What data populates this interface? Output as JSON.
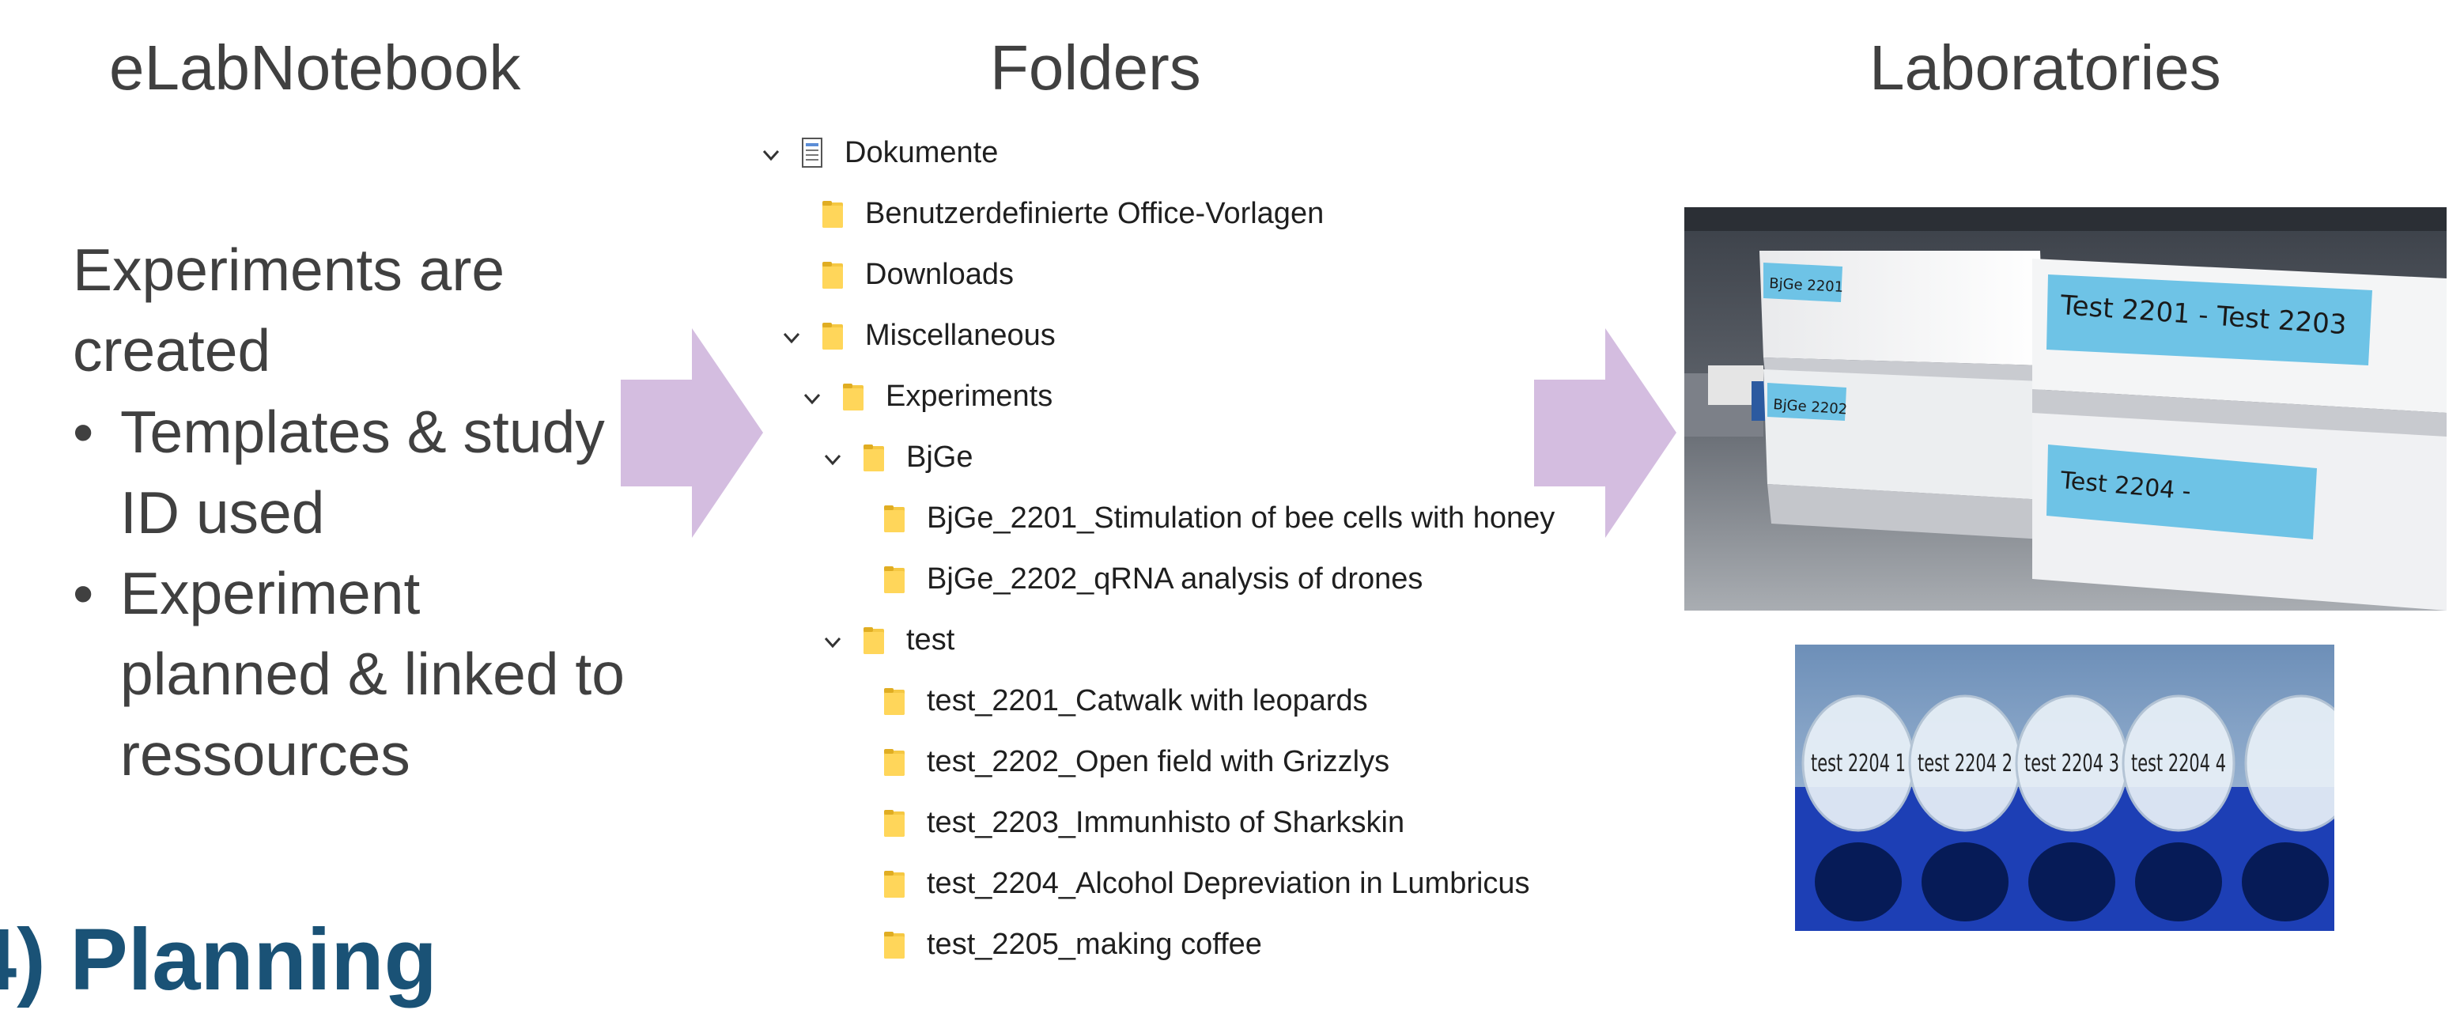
{
  "headings": {
    "elab": "eLabNotebook",
    "folders": "Folders",
    "labs": "Laboratories"
  },
  "left_column": {
    "intro": "Experiments are created",
    "bullets": [
      "Templates & study ID used",
      "Experiment planned & linked to ressources"
    ],
    "section_title_partial": "4) Planning"
  },
  "folder_tree": {
    "nodes": [
      {
        "label": "Dokumente",
        "icon": "document-library-icon",
        "expanded": true,
        "level": 0
      },
      {
        "label": "Benutzerdefinierte Office-Vorlagen",
        "icon": "folder-icon",
        "expanded": false,
        "level": 1
      },
      {
        "label": "Downloads",
        "icon": "folder-icon",
        "expanded": false,
        "level": 1
      },
      {
        "label": "Miscellaneous",
        "icon": "folder-icon",
        "expanded": true,
        "level": 1
      },
      {
        "label": "Experiments",
        "icon": "folder-icon",
        "expanded": true,
        "level": 2
      },
      {
        "label": "BjGe",
        "icon": "folder-icon",
        "expanded": true,
        "level": 3
      },
      {
        "label": "BjGe_2201_Stimulation of bee cells with honey",
        "icon": "folder-icon",
        "expanded": false,
        "level": 4
      },
      {
        "label": "BjGe_2202_qRNA analysis of drones",
        "icon": "folder-icon",
        "expanded": false,
        "level": 4
      },
      {
        "label": "test",
        "icon": "folder-icon",
        "expanded": true,
        "level": 3
      },
      {
        "label": "test_2201_Catwalk with leopards",
        "icon": "folder-icon",
        "expanded": false,
        "level": 4
      },
      {
        "label": "test_2202_Open field with Grizzlys",
        "icon": "folder-icon",
        "expanded": false,
        "level": 4
      },
      {
        "label": "test_2203_Immunhisto of Sharkskin",
        "icon": "folder-icon",
        "expanded": false,
        "level": 4
      },
      {
        "label": "test_2204_Alcohol Depreviation in Lumbricus",
        "icon": "folder-icon",
        "expanded": false,
        "level": 4
      },
      {
        "label": "test_2205_making coffee",
        "icon": "folder-icon",
        "expanded": false,
        "level": 4
      }
    ]
  },
  "photos": {
    "boxes": {
      "labels": [
        "BjGe 2201",
        "BjGe 2202",
        "Test 2201 - Test 2203",
        "Test 2204 -"
      ]
    },
    "tubes": {
      "labels": [
        "test 2204 1",
        "test 2204 2",
        "test 2204 3",
        "test 2204 4"
      ]
    }
  },
  "colors": {
    "text": "#404040",
    "arrow": "#d4bde0",
    "folder": "#f5c843",
    "tape": "#6ec3e6",
    "tray": "#1d3fb5"
  }
}
